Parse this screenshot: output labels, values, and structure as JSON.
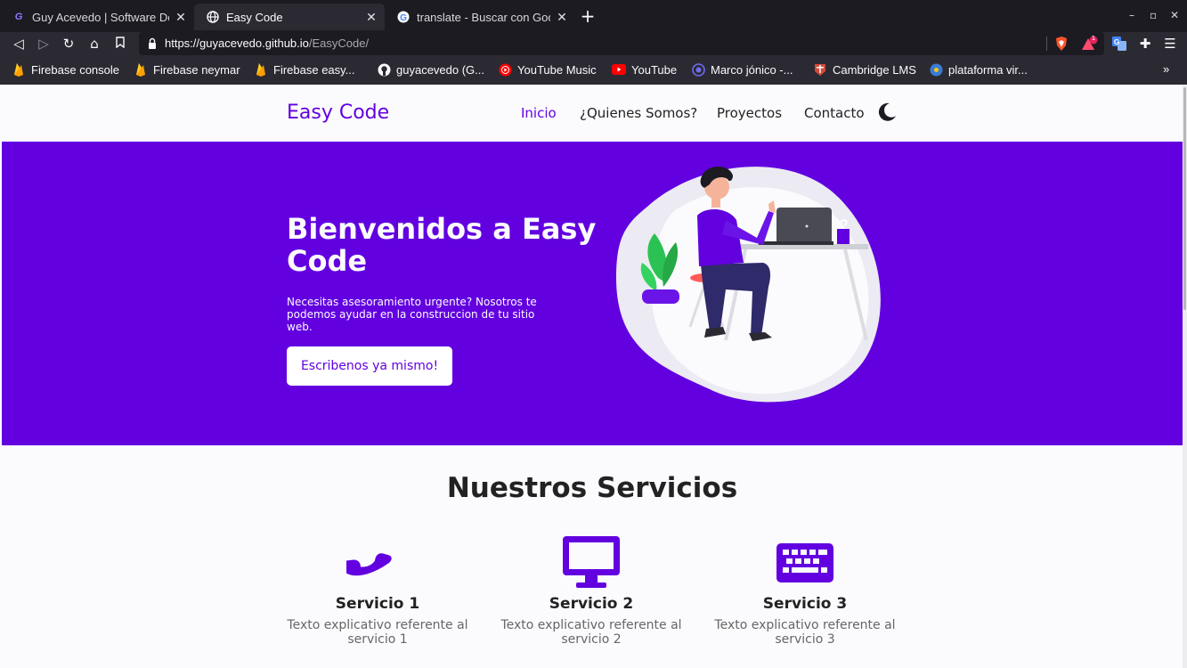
{
  "browser": {
    "tabs": [
      {
        "title": "Guy Acevedo | Software De",
        "active": false,
        "icon": "ga-favicon"
      },
      {
        "title": "Easy Code",
        "active": true,
        "icon": "globe-icon"
      },
      {
        "title": "translate - Buscar con Goo",
        "active": false,
        "icon": "google-icon"
      }
    ],
    "url_host": "https://guyacevedo.github.io",
    "url_path": "/EasyCode/",
    "extension_badge": "1",
    "bookmarks": [
      {
        "label": "Firebase console",
        "icon": "firebase-icon"
      },
      {
        "label": "Firebase neymar",
        "icon": "firebase-icon"
      },
      {
        "label": "Firebase easy...",
        "icon": "firebase-icon"
      },
      {
        "label": "guyacevedo (G...",
        "icon": "github-icon"
      },
      {
        "label": "YouTube Music",
        "icon": "youtube-music-icon"
      },
      {
        "label": "YouTube",
        "icon": "youtube-icon"
      },
      {
        "label": "Marco jónico -...",
        "icon": "circle-icon"
      },
      {
        "label": "Cambridge LMS",
        "icon": "cambridge-icon"
      },
      {
        "label": "plataforma vir...",
        "icon": "globe-blue-icon"
      }
    ],
    "bookmarks_overflow": "»"
  },
  "site": {
    "logo": "Easy Code",
    "nav": [
      "Inicio",
      "¿Quienes Somos?",
      "Proyectos",
      "Contacto"
    ],
    "hero": {
      "title": "Bienvenidos a Easy Code",
      "text": "Necesitas asesoramiento urgente? Nosotros te podemos ayudar en la construccion de tu sitio web.",
      "cta": "Escribenos ya mismo!"
    },
    "services_title": "Nuestros Servicios",
    "services": [
      {
        "title": "Servicio 1",
        "text": "Texto explicativo referente al servicio 1",
        "icon": "phone-icon"
      },
      {
        "title": "Servicio 2",
        "text": "Texto explicativo referente al servicio 2",
        "icon": "monitor-icon"
      },
      {
        "title": "Servicio 3",
        "text": "Texto explicativo referente al servicio 3",
        "icon": "keyboard-icon"
      }
    ]
  },
  "colors": {
    "accent": "#6200e0",
    "chrome_dark": "#1c1b22",
    "chrome": "#2b2a33",
    "page_bg": "#fbfbfe"
  }
}
